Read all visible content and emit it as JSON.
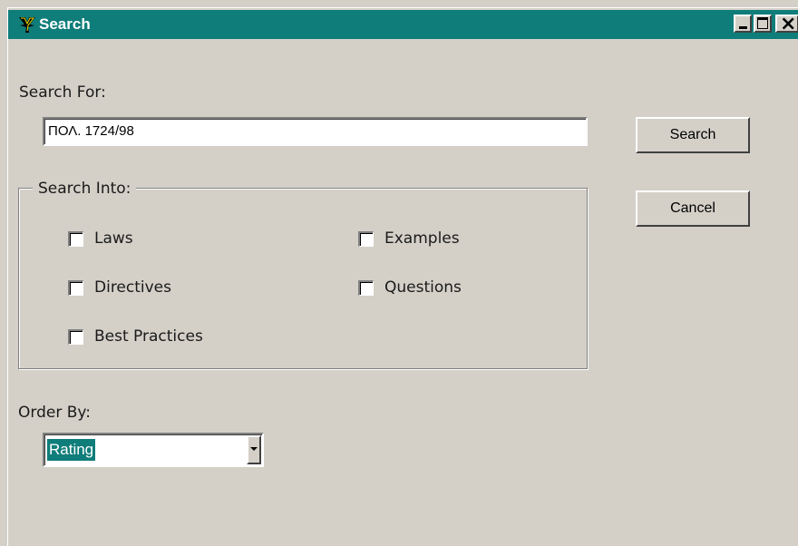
{
  "window": {
    "title": "Search",
    "icon": "app-logo-icon",
    "accent_color": "#0f7d7a",
    "face_color": "#d4d0c8"
  },
  "search": {
    "label": "Search For:",
    "value": "ΠΟΛ. 1724/98"
  },
  "buttons": {
    "search_label": "Search",
    "cancel_label": "Cancel"
  },
  "search_into": {
    "legend": "Search Into:",
    "options": [
      {
        "label": "Laws",
        "checked": false
      },
      {
        "label": "Directives",
        "checked": false
      },
      {
        "label": "Best Practices",
        "checked": false
      },
      {
        "label": "Examples",
        "checked": false
      },
      {
        "label": "Questions",
        "checked": false
      }
    ]
  },
  "order_by": {
    "label": "Order By:",
    "selected": "Rating"
  }
}
